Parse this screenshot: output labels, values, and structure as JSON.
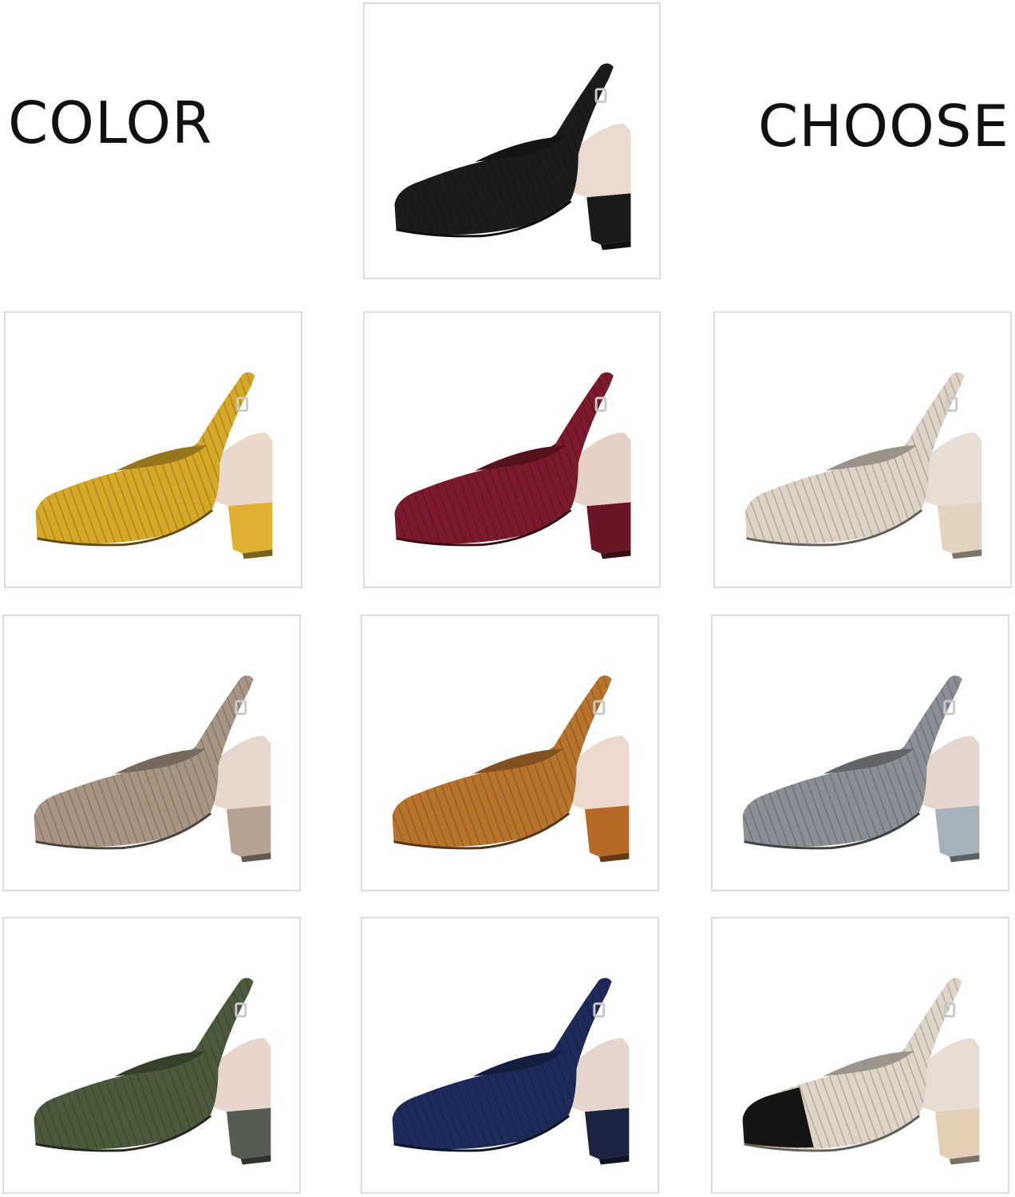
{
  "title_left": "COLOR",
  "title_right": "CHOOSE",
  "swatches": [
    {
      "name": "black",
      "upper": "#1c1c1c",
      "lining": "#e9d9cf",
      "heel": "#1a1a1a"
    },
    {
      "name": "yellow",
      "upper": "#d6a828",
      "lining": "#ead9cb",
      "heel": "#e0b033"
    },
    {
      "name": "burgundy",
      "upper": "#7a1a2a",
      "lining": "#e6d1c8",
      "heel": "#6a1626"
    },
    {
      "name": "beige",
      "upper": "#ddd2c4",
      "lining": "#e8ddd3",
      "heel": "#e3d4c0"
    },
    {
      "name": "taupe",
      "upper": "#a79584",
      "lining": "#e7d8cd",
      "heel": "#b5a293"
    },
    {
      "name": "camel",
      "upper": "#b8742c",
      "lining": "#ead9cc",
      "heel": "#b56a28"
    },
    {
      "name": "grey",
      "upper": "#8a8f95",
      "lining": "#e5d6ce",
      "heel": "#a6b1bb"
    },
    {
      "name": "olive",
      "upper": "#4b5a3c",
      "lining": "#e8d6cc",
      "heel": "#555d52"
    },
    {
      "name": "navy",
      "upper": "#1e2a5a",
      "lining": "#e6d5cc",
      "heel": "#1b2340"
    },
    {
      "name": "beige-black-toe",
      "upper": "#dfd5c7",
      "lining": "#e9ddd3",
      "heel": "#e2cfb5",
      "toe": "#151515"
    }
  ]
}
